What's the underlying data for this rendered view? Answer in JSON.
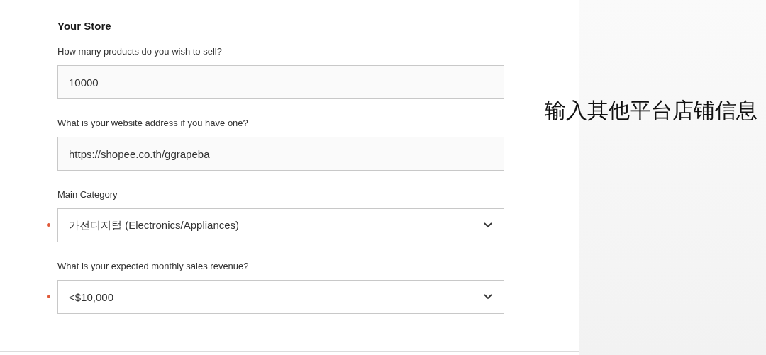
{
  "section_title": "Your Store",
  "fields": [
    {
      "kind": "text",
      "label": "How many products do you wish to sell?",
      "value": "10000",
      "required": false
    },
    {
      "kind": "text",
      "label": "What is your website address if you have one?",
      "value": "https://shopee.co.th/ggrapeba",
      "required": false
    },
    {
      "kind": "select",
      "label": "Main Category",
      "value": "가전디지털 (Electronics/Appliances)",
      "required": true
    },
    {
      "kind": "select",
      "label": "What is your expected monthly sales revenue?",
      "value": "<$10,000",
      "required": true
    }
  ],
  "caption": "输入其他平台店铺信息"
}
